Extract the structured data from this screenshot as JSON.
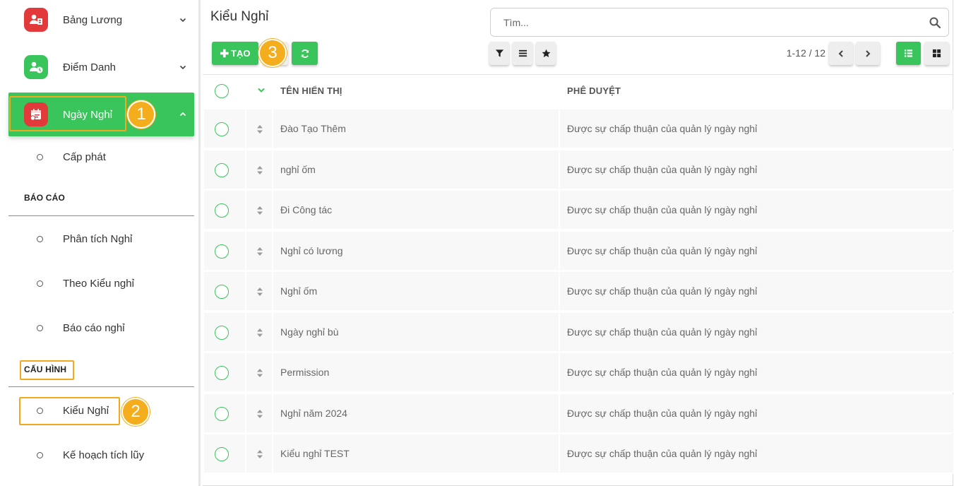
{
  "sidebar": {
    "items": [
      {
        "label": "Bảng Lương",
        "icon": "payroll-icon"
      },
      {
        "label": "Điểm Danh",
        "icon": "attendance-icon"
      },
      {
        "label": "Ngày Nghỉ",
        "icon": "leave-calendar-icon"
      }
    ],
    "sub_leave": [
      {
        "label": "Cấp phát"
      }
    ],
    "report_title": "BÁO CÁO",
    "reports": [
      {
        "label": "Phân tích Nghỉ"
      },
      {
        "label": "Theo Kiểu nghỉ"
      },
      {
        "label": "Báo cáo nghỉ"
      }
    ],
    "config_title": "CẤU HÌNH",
    "configs": [
      {
        "label": "Kiểu Nghỉ"
      },
      {
        "label": "Kế hoạch tích lũy"
      }
    ]
  },
  "badges": [
    "1",
    "2",
    "3"
  ],
  "main": {
    "title": "Kiểu Nghỉ",
    "search_placeholder": "Tìm...",
    "create_label": "TẠO",
    "pager": "1-12 / 12",
    "columns": {
      "name": "TÊN HIỂN THỊ",
      "approval": "PHÊ DUYỆT"
    },
    "rows": [
      {
        "name": "Đào Tạo Thêm",
        "approval": "Được sự chấp thuận của quản lý ngày nghỉ"
      },
      {
        "name": "nghỉ ốm",
        "approval": "Được sự chấp thuận của quản lý ngày nghỉ"
      },
      {
        "name": "Đi Công tác",
        "approval": "Được sự chấp thuận của quản lý ngày nghỉ"
      },
      {
        "name": "Nghỉ có lương",
        "approval": "Được sự chấp thuận của quản lý ngày nghỉ"
      },
      {
        "name": "Nghỉ ốm",
        "approval": "Được sự chấp thuận của quản lý ngày nghỉ"
      },
      {
        "name": "Ngày nghỉ bù",
        "approval": "Được sự chấp thuận của quản lý ngày nghỉ"
      },
      {
        "name": "Permission",
        "approval": "Được sự chấp thuận của quản lý ngày nghỉ"
      },
      {
        "name": "Nghỉ năm 2024",
        "approval": "Được sự chấp thuận của quản lý ngày nghỉ"
      },
      {
        "name": "Kiểu nghỉ TEST",
        "approval": "Được sự chấp thuận của quản lý ngày nghỉ"
      }
    ]
  },
  "colors": {
    "accent": "#3ac45c",
    "highlight": "#f4ad1c",
    "menu_icon_red": "#e23a3a",
    "menu_icon_green": "#3ac45c"
  }
}
